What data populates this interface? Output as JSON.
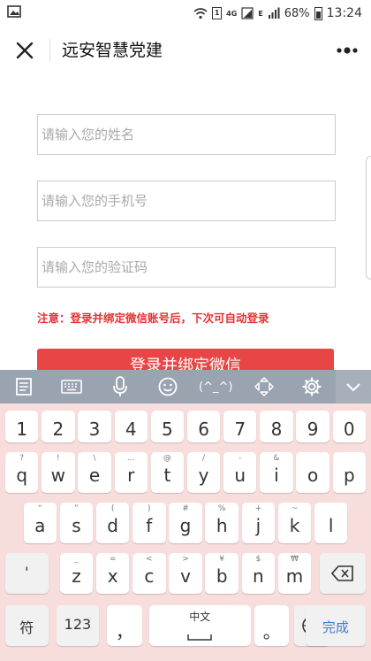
{
  "status_bar": {
    "network_4g": "4G",
    "network_e": "E",
    "sim_badge": "1",
    "battery": "68%",
    "time": "13:24"
  },
  "nav": {
    "title": "远安智慧党建"
  },
  "form": {
    "name_placeholder": "请输入您的姓名",
    "phone_placeholder": "请输入您的手机号",
    "code_placeholder": "请输入您的验证码",
    "notice": "注意：登录并绑定微信账号后，下次可自动登录",
    "submit_label": "登录并绑定微信"
  },
  "keyboard_toolbar": {
    "emoticon_label": "(^_^)"
  },
  "keyboard": {
    "number_row": [
      "1",
      "2",
      "3",
      "4",
      "5",
      "6",
      "7",
      "8",
      "9",
      "0"
    ],
    "row1": [
      "q",
      "w",
      "e",
      "r",
      "t",
      "y",
      "u",
      "i",
      "o",
      "p"
    ],
    "row1_hints": [
      "?",
      "!",
      "\\",
      "...",
      "@",
      "/",
      "-",
      "&",
      "",
      ""
    ],
    "row2": [
      "a",
      "s",
      "d",
      "f",
      "g",
      "h",
      "j",
      "k",
      "l"
    ],
    "row2_hints": [
      "“",
      "”",
      "(",
      ")",
      "#",
      "%",
      "+",
      "~",
      ""
    ],
    "row3": [
      "z",
      "x",
      "c",
      "v",
      "b",
      "n",
      "m"
    ],
    "row3_hints": [
      "_",
      "=",
      "<",
      ">",
      "¥",
      "$",
      "₩"
    ],
    "apostrophe": "'",
    "symbol_key": "符",
    "num_key": "123",
    "comma_key": "，",
    "space_label": "中文",
    "period_key": "。",
    "done_key": "完成"
  },
  "colors": {
    "accent_red": "#e84646",
    "notice_red": "#e53232",
    "keyboard_bg": "#f7dedd",
    "toolbar_bg": "#9aa3b0",
    "done_blue": "#3a7bd5"
  }
}
